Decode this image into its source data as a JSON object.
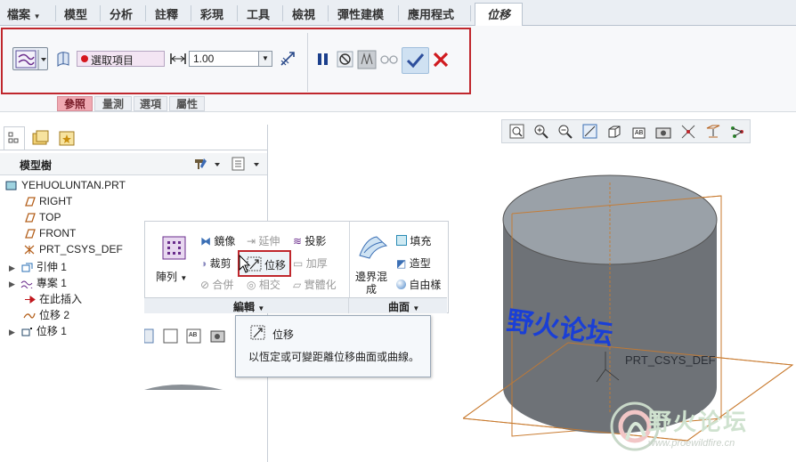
{
  "menu": {
    "file": "檔案",
    "tabs": [
      "模型",
      "分析",
      "註釋",
      "彩現",
      "工具",
      "檢視",
      "彈性建模",
      "應用程式"
    ],
    "active_tab": "位移"
  },
  "dashboard": {
    "collector_text": "選取項目",
    "offset_value": "1.00",
    "subtabs": [
      "參照",
      "量測",
      "選項",
      "屬性"
    ]
  },
  "left_pane": {
    "model_tree_label": "模型樹",
    "items": [
      {
        "label": "YEHUOLUNTAN.PRT",
        "icon": "part-icon"
      },
      {
        "label": "RIGHT",
        "icon": "datum-plane-icon"
      },
      {
        "label": "TOP",
        "icon": "datum-plane-icon"
      },
      {
        "label": "FRONT",
        "icon": "datum-plane-icon"
      },
      {
        "label": "PRT_CSYS_DEF",
        "icon": "csys-icon"
      },
      {
        "label": "引伸 1",
        "icon": "extrude-icon"
      },
      {
        "label": "專案 1",
        "icon": "project-icon"
      },
      {
        "label": "在此插入",
        "icon": "insert-arrow-icon"
      },
      {
        "label": "位移 2",
        "icon": "curve-icon"
      },
      {
        "label": "位移 1",
        "icon": "surface-icon"
      }
    ]
  },
  "ribbon": {
    "pattern": "陣列",
    "mirror": "鏡像",
    "extend": "延伸",
    "project": "投影",
    "trim": "裁剪",
    "offset": "位移",
    "thicken": "加厚",
    "merge": "合併",
    "intersect": "相交",
    "solidify": "實體化",
    "boundary_blend_1": "邊界混",
    "boundary_blend_2": "成",
    "fill": "填充",
    "style": "造型",
    "freestyle": "自由樣",
    "group_edit": "編輯",
    "group_surface": "曲面"
  },
  "tooltip": {
    "title": "位移",
    "description": "以恆定或可變距離位移曲面或曲線。"
  },
  "viewport": {
    "watermark_text": "野火论坛",
    "csys_label": "PRT_CSYS_DEF",
    "model_text": "野火论坛",
    "watermark_url": "www.proewildfire.cn"
  },
  "colors": {
    "highlight_red": "#c0272d",
    "cylinder_side": "#6e7277",
    "cylinder_top": "#9aa1a8",
    "datum_orange": "#c87a2e",
    "text_blue": "#1a3fd6"
  }
}
